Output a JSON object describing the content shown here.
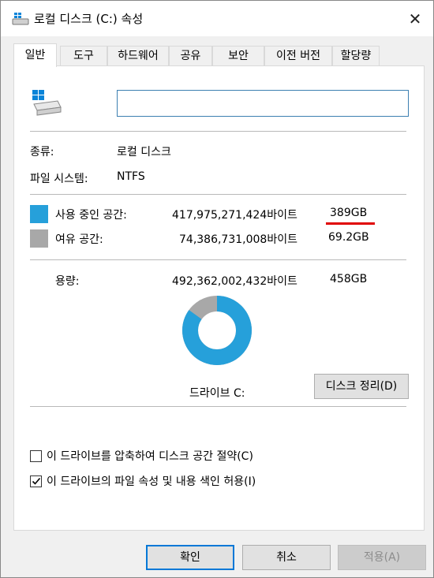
{
  "window": {
    "title": "로컬 디스크 (C:) 속성",
    "close_icon": "close-icon"
  },
  "tabs": [
    {
      "label": "일반",
      "active": true
    },
    {
      "label": "도구",
      "active": false
    },
    {
      "label": "하드웨어",
      "active": false
    },
    {
      "label": "공유",
      "active": false
    },
    {
      "label": "보안",
      "active": false
    },
    {
      "label": "이전 버전",
      "active": false
    },
    {
      "label": "할당량",
      "active": false
    }
  ],
  "general": {
    "name_value": "",
    "type_label": "종류:",
    "type_value": "로컬 디스크",
    "fs_label": "파일 시스템:",
    "fs_value": "NTFS",
    "used": {
      "label": "사용 중인 공간:",
      "bytes": "417,975,271,424바이트",
      "size": "389GB",
      "color": "#26a0da"
    },
    "free": {
      "label": "여유 공간:",
      "bytes": "74,386,731,008바이트",
      "size": "69.2GB",
      "color": "#a8a8a8"
    },
    "capacity": {
      "label": "용량:",
      "bytes": "492,362,002,432바이트",
      "size": "458GB"
    },
    "drive_label": "드라이브 C:",
    "cleanup_button": "디스크 정리(D)",
    "compress_label": "이 드라이브를 압축하여 디스크 공간 절약(C)",
    "compress_checked": false,
    "index_label": "이 드라이브의 파일 속성 및 내용 색인 허용(I)",
    "index_checked": true,
    "used_fraction": 0.849
  },
  "buttons": {
    "ok": "확인",
    "cancel": "취소",
    "apply": "적용(A)"
  }
}
